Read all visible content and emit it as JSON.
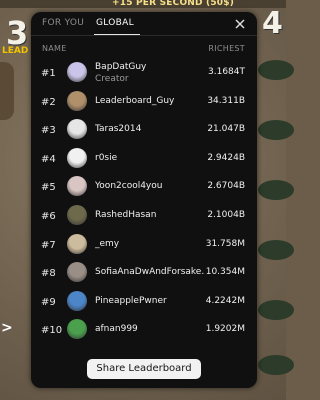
{
  "background": {
    "per_second": "+15 PER SECOND (50$)",
    "big_number_left": "3",
    "leaderboard_fragment": "LEAD",
    "big_number_right": "4",
    "chevron": ">"
  },
  "tabs": [
    {
      "label": "FOR YOU",
      "active": false
    },
    {
      "label": "GLOBAL",
      "active": true
    }
  ],
  "columns": {
    "name": "NAME",
    "value": "RICHEST"
  },
  "rows": [
    {
      "rank": "#1",
      "name": "BapDatGuy",
      "sub": "Creator",
      "value": "3.1684T",
      "avatar_icon": "swirl-avatar-icon",
      "avatar_color": "#c9c4e8"
    },
    {
      "rank": "#2",
      "name": "Leaderboard_Guy",
      "value": "34.311B",
      "avatar_icon": "photo-avatar-icon",
      "avatar_color": "#b08f6b"
    },
    {
      "rank": "#3",
      "name": "Taras2014",
      "value": "21.047B",
      "avatar_icon": "mask-avatar-icon",
      "avatar_color": "#e6e6e6"
    },
    {
      "rank": "#4",
      "name": "r0sie",
      "value": "2.9424B",
      "avatar_icon": "bw-avatar-icon",
      "avatar_color": "#f1f1f1"
    },
    {
      "rank": "#5",
      "name": "Yoon2cool4you",
      "value": "2.6704B",
      "avatar_icon": "photo-avatar-icon",
      "avatar_color": "#d9c6c4"
    },
    {
      "rank": "#6",
      "name": "RashedHasan",
      "value": "2.1004B",
      "avatar_icon": "photo-avatar-icon",
      "avatar_color": "#6d6a4c"
    },
    {
      "rank": "#7",
      "name": "_emy",
      "value": "31.758M",
      "avatar_icon": "photo-avatar-icon",
      "avatar_color": "#cdbb9d"
    },
    {
      "rank": "#8",
      "name": "SofiaAnaDwAndForsake...",
      "value": "10.354M",
      "avatar_icon": "photo-avatar-icon",
      "avatar_color": "#9a8f86"
    },
    {
      "rank": "#9",
      "name": "PineapplePwner",
      "value": "4.2242M",
      "avatar_icon": "photo-avatar-icon",
      "avatar_color": "#4c86c9"
    },
    {
      "rank": "#10",
      "name": "afnan999",
      "value": "1.9202M",
      "avatar_icon": "photo-avatar-icon",
      "avatar_color": "#4aa04d"
    }
  ],
  "share_button": "Share Leaderboard",
  "colors": {
    "modal_bg": "#101010",
    "text": "#f0f0f0",
    "muted": "#8d8d8d",
    "button_bg": "#f2f2f2"
  }
}
